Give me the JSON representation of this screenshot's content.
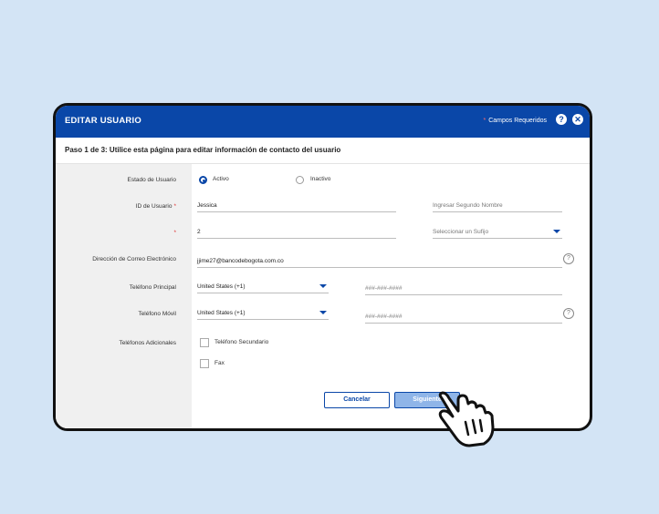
{
  "header": {
    "title": "EDITAR USUARIO",
    "required_star": "*",
    "required_label": "Campos Requeridos",
    "help_icon": "?",
    "close_icon": "✕"
  },
  "step": "Paso 1 de 3: Utilice esta página para editar información de contacto del usuario",
  "form": {
    "status_label": "Estado de Usuario",
    "status_active": "Activo",
    "status_inactive": "Inactivo",
    "id_label": "ID de Usuario",
    "required_mark": "*",
    "first_name": "Jessica",
    "middle_name_placeholder": "Ingresar Segundo Nombre",
    "last_name": "2",
    "suffix_placeholder": "Seleccionar un Sufijo",
    "email_label": "Dirección de Correo Electrónico",
    "email": "jjime27@bancodebogota.com.co",
    "help_icon": "?",
    "phone_main_label": "Teléfono Principal",
    "phone_main_country": "United States (+1)",
    "phone_main_placeholder": "###-###-####",
    "phone_mobile_label": "Teléfono Móvil",
    "phone_mobile_country": "United States (+1)",
    "phone_mobile_placeholder": "###-###-####",
    "additional_label": "Teléfonos Adicionales",
    "secondary_phone": "Teléfono Secundario",
    "fax": "Fax"
  },
  "buttons": {
    "cancel": "Cancelar",
    "next": "Siguiente"
  },
  "colors": {
    "primary": "#0a47a8",
    "background": "#d3e4f5",
    "required": "#d33"
  }
}
